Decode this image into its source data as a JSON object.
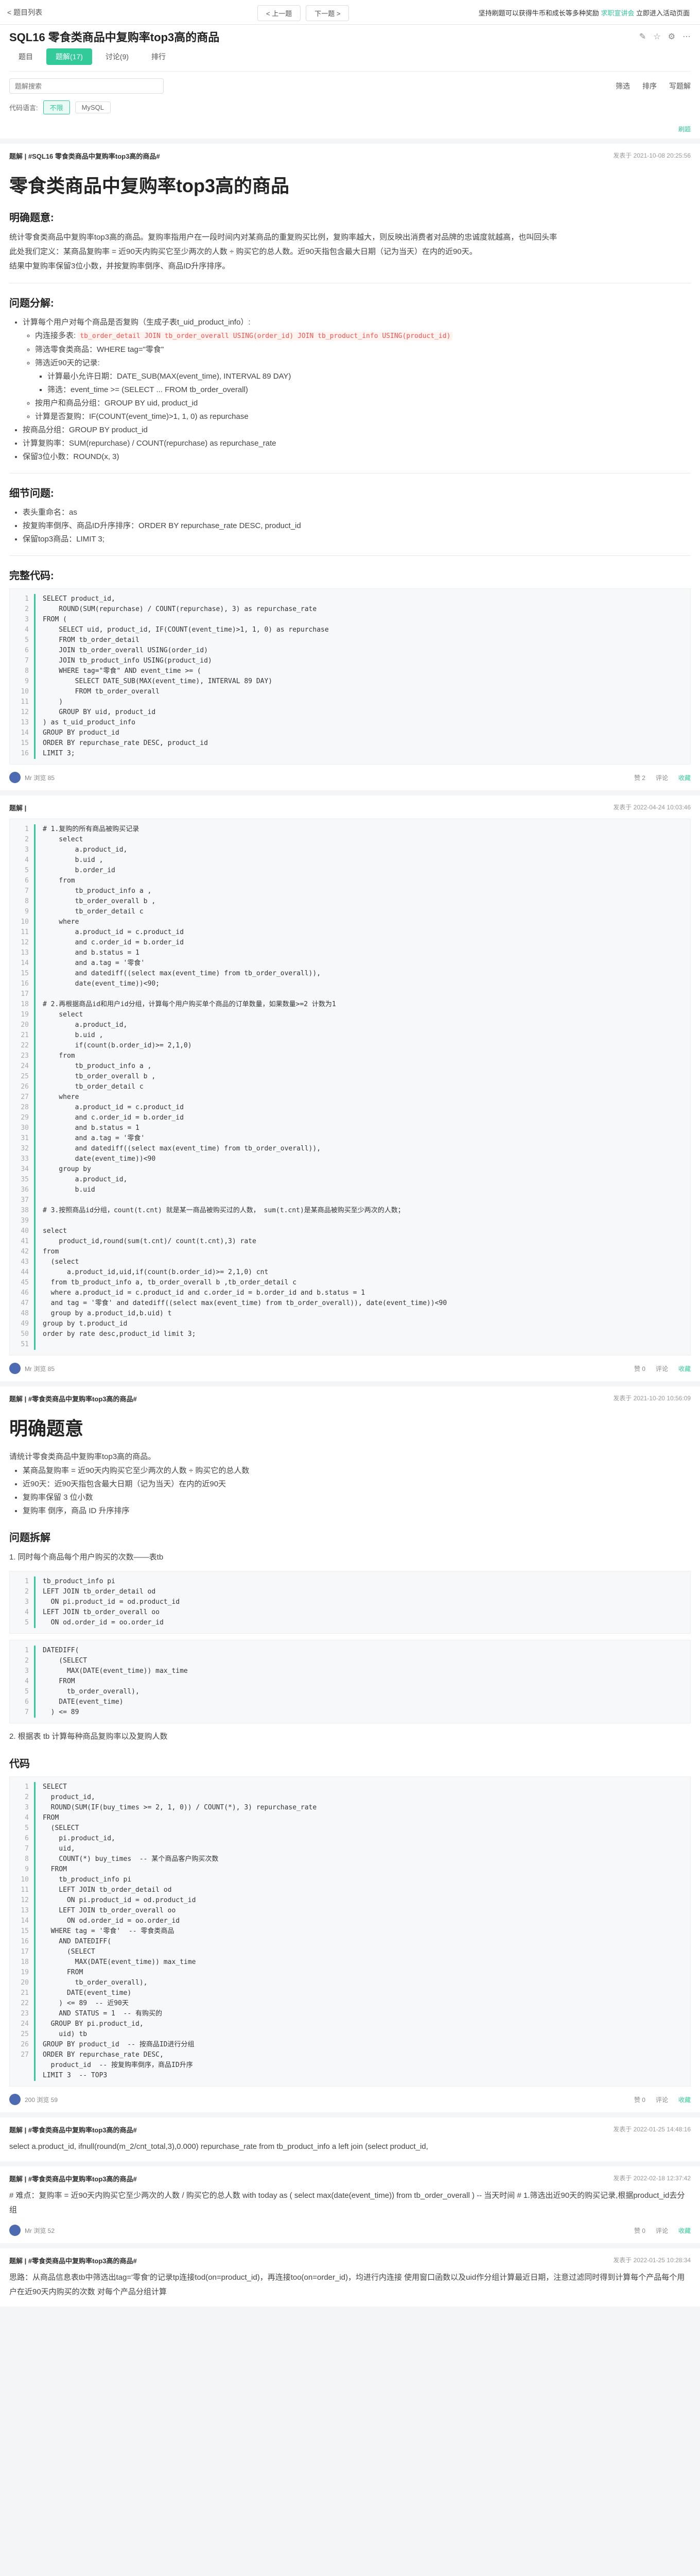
{
  "topbar": {
    "back": "< 题目列表",
    "prev": "< 上一题",
    "next": "下一题 >",
    "promo_prefix": "坚持刷题可以获得牛币和成长等多种奖励",
    "promo_link": "求职宣讲会",
    "promo_suffix": "立即进入活动页面"
  },
  "header": {
    "title": "SQL16  零食类商品中复购率top3高的商品",
    "tabs": [
      "题目",
      "题解(17)",
      "讨论(9)",
      "排行"
    ],
    "search_placeholder": "题解搜索",
    "filter": "筛选",
    "sort": "排序",
    "write": "写题解",
    "lang_label": "代码语言:",
    "langs": [
      "不限",
      "MySQL"
    ],
    "hint": "刷题"
  },
  "posts": [
    {
      "title": "题解 | #SQL16 零食类商品中复购率top3高的商品#",
      "date": "发表于 2021-10-08 20:25:56",
      "heading": "零食类商品中复购率top3高的商品",
      "s1": "明确题意:",
      "p1": "统计零食类商品中复购率top3高的商品。复购率指用户在一段时间内对某商品的重复购买比例，复购率越大，则反映出消费者对品牌的忠诚度就越高，也叫回头率",
      "p2": "此处我们定义：某商品复购率 = 近90天内购买它至少两次的人数 ÷ 购买它的总人数。近90天指包含最大日期（记为当天）在内的近90天。",
      "p3": "结果中复购率保留3位小数，并按复购率倒序、商品ID升序排序。",
      "s2": "问题分解:",
      "l1": "计算每个用户对每个商品是否复购（生成子表t_uid_product_info）:",
      "l1a": "内连接多表:",
      "l1a_code": "tb_order_detail JOIN tb_order_overall USING(order_id) JOIN tb_product_info USING(product_id)",
      "l1b": "筛选零食类商品：WHERE tag=\"零食\"",
      "l1c": "筛选近90天的记录:",
      "l1c1": "计算最小允许日期：DATE_SUB(MAX(event_time), INTERVAL 89 DAY)",
      "l1c2": "筛选：event_time >= (SELECT ... FROM tb_order_overall)",
      "l1d": "按用户和商品分组：GROUP BY uid, product_id",
      "l1e": "计算是否复购：IF(COUNT(event_time)>1, 1, 0) as repurchase",
      "l2": "按商品分组：GROUP BY product_id",
      "l3": "计算复购率：SUM(repurchase) / COUNT(repurchase) as repurchase_rate",
      "l4": "保留3位小数：ROUND(x, 3)",
      "s3": "细节问题:",
      "d1": "表头重命名：as",
      "d2": "按复购率倒序、商品ID升序排序：ORDER BY repurchase_rate DESC, product_id",
      "d3": "保留top3商品：LIMIT 3;",
      "s4": "完整代码:",
      "code": "SELECT product_id,\n    ROUND(SUM(repurchase) / COUNT(repurchase), 3) as repurchase_rate\nFROM (\n    SELECT uid, product_id, IF(COUNT(event_time)>1, 1, 0) as repurchase\n    FROM tb_order_detail\n    JOIN tb_order_overall USING(order_id)\n    JOIN tb_product_info USING(product_id)\n    WHERE tag=\"零食\" AND event_time >= (\n        SELECT DATE_SUB(MAX(event_time), INTERVAL 89 DAY)\n        FROM tb_order_overall\n    )\n    GROUP BY uid, product_id\n) as t_uid_product_info\nGROUP BY product_id\nORDER BY repurchase_rate DESC, product_id\nLIMIT 3;",
      "user": "Mr 浏览 85",
      "acts": [
        "赞 2",
        "评论",
        "收藏"
      ]
    },
    {
      "title": "题解 |",
      "date": "发表于 2022-04-24 10:03:46",
      "code": "# 1.复购的所有商品被购买记录\n    select\n        a.product_id,\n        b.uid ,\n        b.order_id\n    from\n        tb_product_info a ,\n        tb_order_overall b ,\n        tb_order_detail c\n    where\n        a.product_id = c.product_id\n        and c.order_id = b.order_id\n        and b.status = 1\n        and a.tag = '零食'\n        and datediff((select max(event_time) from tb_order_overall)),\n        date(event_time))<90;\n\n# 2.再根据商品id和用户id分组，计算每个用户购买单个商品的订单数量，如果数量>=2 计数为1\n    select\n        a.product_id,\n        b.uid ,\n        if(count(b.order_id)>= 2,1,0)\n    from\n        tb_product_info a ,\n        tb_order_overall b ,\n        tb_order_detail c\n    where\n        a.product_id = c.product_id\n        and c.order_id = b.order_id\n        and b.status = 1\n        and a.tag = '零食'\n        and datediff((select max(event_time) from tb_order_overall)),\n        date(event_time))<90\n    group by\n        a.product_id,\n        b.uid\n\n# 3.按照商品id分组，count(t.cnt) 就是某一商品被购买过的人数， sum(t.cnt)是某商品被购买至少两次的人数；\n\nselect\n    product_id,round(sum(t.cnt)/ count(t.cnt),3) rate\nfrom\n  (select\n      a.product_id,uid,if(count(b.order_id)>= 2,1,0) cnt\n  from tb_product_info a, tb_order_overall b ,tb_order_detail c\n  where a.product_id = c.product_id and c.order_id = b.order_id and b.status = 1\n  and tag = '零食' and datediff((select max(event_time) from tb_order_overall)), date(event_time))<90\n  group by a.product_id,b.uid) t\ngroup by t.product_id\norder by rate desc,product_id limit 3;",
      "user": "Mr 浏览 85",
      "acts": [
        "赞 0",
        "评论",
        "收藏"
      ]
    },
    {
      "title": "题解 | #零食类商品中复购率top3高的商品#",
      "date": "发表于 2021-10-20 10:56:09",
      "heading": "明确题意",
      "p1": "请统计零食类商品中复购率top3高的商品。",
      "b1": "某商品复购率 = 近90天内购买它至少两次的人数 ÷ 购买它的总人数",
      "b2": "近90天：近90天指包含最大日期（记为当天）在内的近90天",
      "b3": "复购率保留 3 位小数",
      "b4": "复购率 倒序，商品 ID 升序排序",
      "s2": "问题拆解",
      "s2a": "1. 同时每个商品每个用户购买的次数——表tb",
      "s2b": "2. 根据表 tb 计算每种商品复购率以及复购人数",
      "code1": "tb_product_info pi\nLEFT JOIN tb_order_detail od\n  ON pi.product_id = od.product_id\nLEFT JOIN tb_order_overall oo\n  ON od.order_id = oo.order_id",
      "code2": "DATEDIFF(\n    (SELECT\n      MAX(DATE(event_time)) max_time\n    FROM\n      tb_order_overall),\n    DATE(event_time)\n  ) <= 89",
      "s3": "代码",
      "code3": "SELECT\n  product_id,\n  ROUND(SUM(IF(buy_times >= 2, 1, 0)) / COUNT(*), 3) repurchase_rate\nFROM\n  (SELECT\n    pi.product_id,\n    uid,\n    COUNT(*) buy_times  -- 某个商品客户购买次数\n  FROM\n    tb_product_info pi\n    LEFT JOIN tb_order_detail od\n      ON pi.product_id = od.product_id\n    LEFT JOIN tb_order_overall oo\n      ON od.order_id = oo.order_id\n  WHERE tag = '零食'  -- 零食类商品\n    AND DATEDIFF(\n      (SELECT\n        MAX(DATE(event_time)) max_time\n      FROM\n        tb_order_overall),\n      DATE(event_time)\n    ) <= 89  -- 近90天\n    AND STATUS = 1  -- 有购买的\n  GROUP BY pi.product_id,\n    uid) tb\nGROUP BY product_id  -- 按商品ID进行分组\nORDER BY repurchase_rate DESC,\n  product_id  -- 按复购率倒序，商品ID升序\nLIMIT 3  -- TOP3",
      "user": "200 浏览 59",
      "acts": [
        "赞 0",
        "评论",
        "收藏"
      ]
    },
    {
      "title": "题解 | #零食类商品中复购率top3高的商品#",
      "date": "发表于 2022-01-25 14:48:16",
      "body": "select a.product_id, ifnull(round(m_2/cnt_total,3),0.000) repurchase_rate from tb_product_info a left join (select product_id,",
      "user": "",
      "acts": []
    },
    {
      "title": "题解 | #零食类商品中复购率top3高的商品#",
      "date": "发表于 2022-02-18 12:37:42",
      "body": "# 难点：复购率 = 近90天内购买它至少两次的人数 / 购买它的总人数 with today as ( select max(date(event_time)) from tb_order_overall ) -- 当天时间 # 1.筛选出近90天的购买记录,根据product_id去分组",
      "user": "Mr 浏览 52",
      "acts": [
        "赞 0",
        "评论",
        "收藏"
      ]
    },
    {
      "title": "题解 | #零食类商品中复购率top3高的商品#",
      "date": "发表于 2022-01-25 10:28:34",
      "body": "思路：从商品信息表tb中筛选出tag='零食'的记录tp连接tod(on=product_id)，再连接too(on=order_id)，均进行内连接 使用窗口函数以及uid作分组计算最近日期，注意过滤同时得到计算每个产品每个用户在近90天内购买的次数 对每个产品分组计算",
      "user": "",
      "acts": []
    }
  ]
}
